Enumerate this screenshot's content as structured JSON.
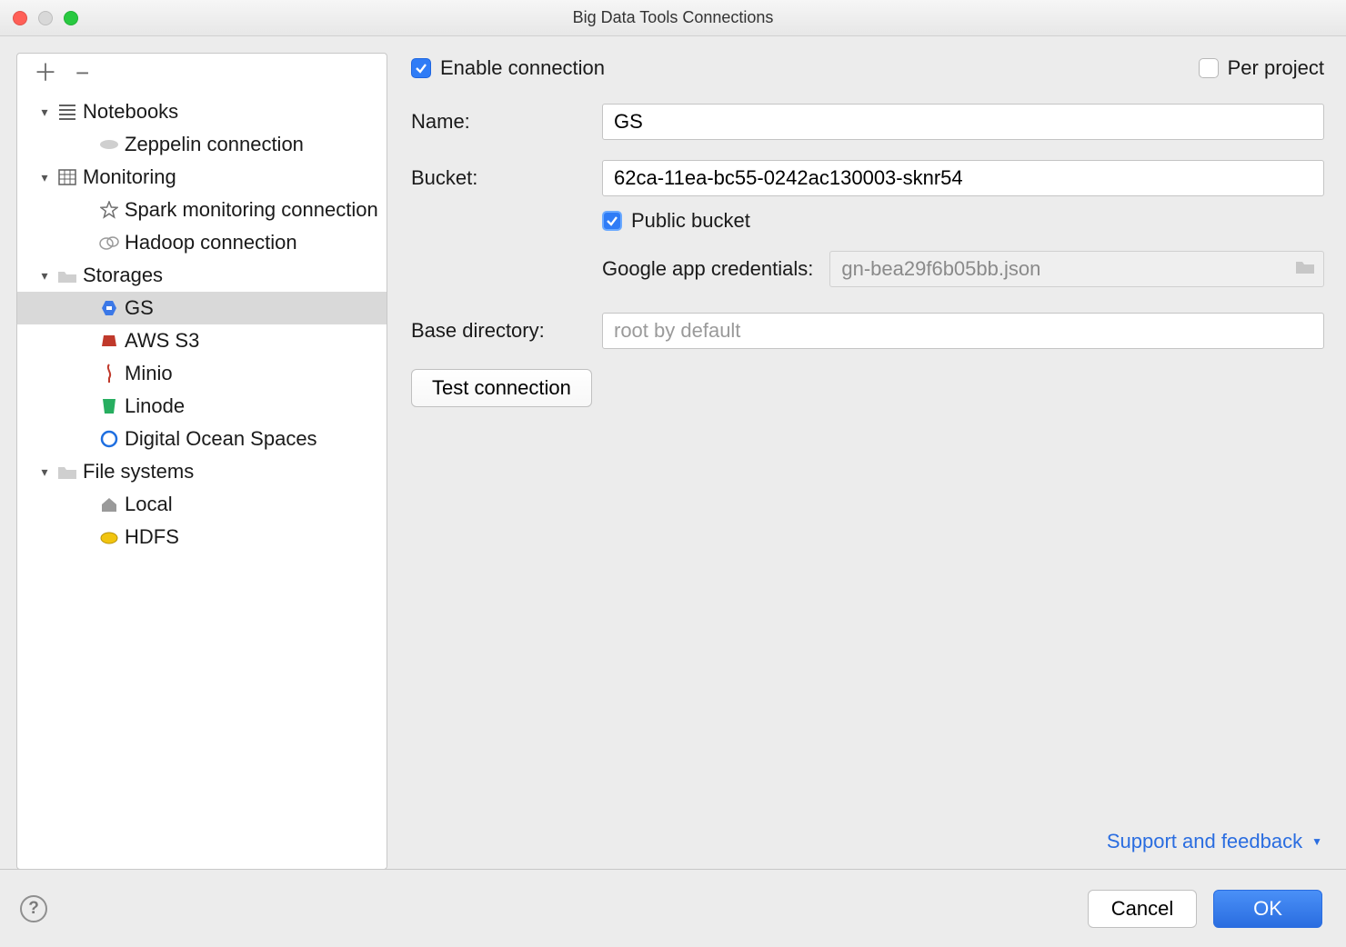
{
  "window": {
    "title": "Big Data Tools Connections"
  },
  "sidebar": {
    "groups": [
      {
        "label": "Notebooks",
        "icon": "lines-icon",
        "items": [
          {
            "label": "Zeppelin connection",
            "icon": "zeppelin-icon"
          }
        ]
      },
      {
        "label": "Monitoring",
        "icon": "grid-icon",
        "items": [
          {
            "label": "Spark monitoring connection",
            "icon": "star-icon"
          },
          {
            "label": "Hadoop connection",
            "icon": "hadoop-icon"
          }
        ]
      },
      {
        "label": "Storages",
        "icon": "folder-cloud-icon",
        "items": [
          {
            "label": "GS",
            "icon": "gs-icon",
            "selected": true
          },
          {
            "label": "AWS S3",
            "icon": "aws-icon"
          },
          {
            "label": "Minio",
            "icon": "minio-icon"
          },
          {
            "label": "Linode",
            "icon": "linode-icon"
          },
          {
            "label": "Digital Ocean Spaces",
            "icon": "do-icon"
          }
        ]
      },
      {
        "label": "File systems",
        "icon": "folder-icon",
        "items": [
          {
            "label": "Local",
            "icon": "home-icon"
          },
          {
            "label": "HDFS",
            "icon": "hdfs-icon"
          }
        ]
      }
    ]
  },
  "form": {
    "enable_label": "Enable connection",
    "enable_checked": true,
    "per_project_label": "Per project",
    "per_project_checked": false,
    "name_label": "Name:",
    "name_value": "GS",
    "bucket_label": "Bucket:",
    "bucket_value": "62ca-11ea-bc55-0242ac130003-sknr54",
    "public_bucket_label": "Public bucket",
    "public_bucket_checked": true,
    "credentials_label": "Google app credentials:",
    "credentials_value": "gn-bea29f6b05bb.json",
    "base_dir_label": "Base directory:",
    "base_dir_placeholder": "root by default",
    "base_dir_value": "",
    "test_button": "Test connection"
  },
  "support_link": "Support and feedback",
  "footer": {
    "cancel": "Cancel",
    "ok": "OK"
  }
}
